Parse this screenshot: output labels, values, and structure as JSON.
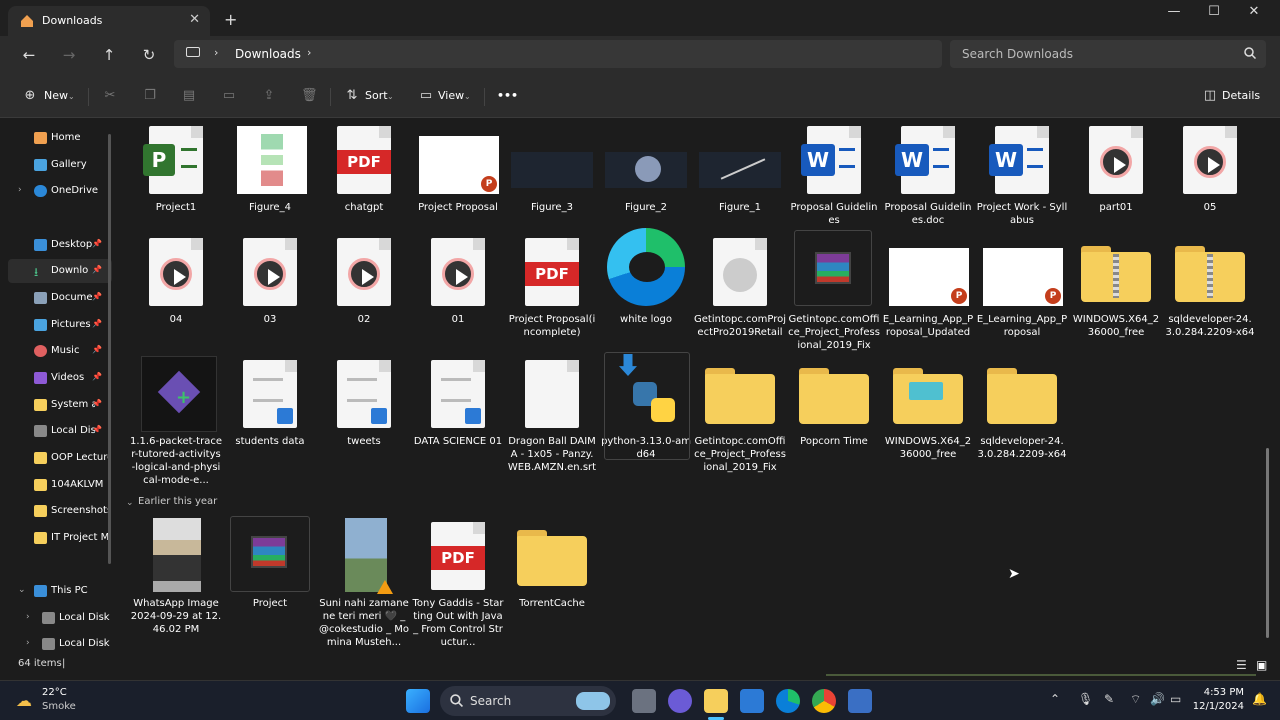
{
  "window": {
    "tab_title": "Downloads",
    "tab_close": "✕",
    "new_tab": "+",
    "minimize": "—",
    "maximize": "☐",
    "close": "✕"
  },
  "address": {
    "path": "Downloads",
    "search_placeholder": "Search Downloads"
  },
  "toolbar": {
    "new_label": "New",
    "sort_label": "Sort",
    "view_label": "View",
    "more_label": "•••",
    "details_label": "Details"
  },
  "sidebar": {
    "items": [
      {
        "label": "Home",
        "color": "#f0a050"
      },
      {
        "label": "Gallery",
        "color": "#4aa3df"
      },
      {
        "label": "OneDrive",
        "color": "#2b88d8"
      },
      {
        "label": "Desktop",
        "color": "#3a8fd9"
      },
      {
        "label": "Downlo",
        "color": "#4cc38a"
      },
      {
        "label": "Docume",
        "color": "#8aa0b8"
      },
      {
        "label": "Pictures",
        "color": "#4aa3df"
      },
      {
        "label": "Music",
        "color": "#e06060"
      },
      {
        "label": "Videos",
        "color": "#8e5ad6"
      },
      {
        "label": "System a",
        "color": "#f6cf5c"
      },
      {
        "label": "Local Dis",
        "color": "#888888"
      },
      {
        "label": "OOP Lecture",
        "color": "#f6cf5c"
      },
      {
        "label": "104AKLVM",
        "color": "#f6cf5c"
      },
      {
        "label": "Screenshots",
        "color": "#f6cf5c"
      },
      {
        "label": "IT Project M",
        "color": "#f6cf5c"
      },
      {
        "label": "This PC",
        "color": "#3a8fd9"
      },
      {
        "label": "Local Disk",
        "color": "#888888"
      },
      {
        "label": "Local Disk",
        "color": "#888888"
      }
    ]
  },
  "files": {
    "row1": [
      "Project1",
      "Figure_4",
      "chatgpt",
      "Project Proposal",
      "Figure_3",
      "Figure_2",
      "Figure_1",
      "Proposal Guidelines",
      "Proposal Guidelines.doc",
      "Project Work - Syllabus",
      "part01",
      "05"
    ],
    "row2": [
      "04",
      "03",
      "02",
      "01",
      "Project Proposal(incomplete)",
      "white logo",
      "Getintopc.comProjectPro2019Retail",
      "Getintopc.comOffice_Project_Professional_2019_Fix",
      "E_Learning_App_Proposal_Updated",
      "E_Learning_App_Proposal",
      "WINDOWS.X64_236000_free",
      "sqldeveloper-24.3.0.284.2209-x64"
    ],
    "row3": [
      "1.1.6-packet-tracer-tutored-activitys-logical-and-physical-mode-e...",
      "students data",
      "tweets",
      "DATA SCIENCE 01",
      "Dragon Ball DAIMA - 1x05 - Panzy.WEB.AMZN.en.srt",
      "python-3.13.0-amd64",
      "Getintopc.comOffice_Project_Professional_2019_Fix",
      "Popcorn Time",
      "WINDOWS.X64_236000_free",
      "sqldeveloper-24.3.0.284.2209-x64"
    ],
    "group_header": "Earlier this year",
    "row4": [
      "WhatsApp Image 2024-09-29 at 12.46.02 PM",
      "Project",
      "Suni nahi zamane ne teri meri 🖤 _ @cokestudio _ Momina Musteh...",
      "Tony Gaddis - Starting Out with Java_ From Control Structur...",
      "TorrentCache"
    ]
  },
  "badges": {
    "pdf": "PDF",
    "word": "W",
    "project": "P",
    "ppt": "P"
  },
  "status": {
    "count": "64 items"
  },
  "taskbar": {
    "temp": "22°C",
    "weather": "Smoke",
    "search": "Search",
    "time": "4:53 PM",
    "date": "12/1/2024"
  },
  "colors": {
    "bg": "#1c1c1c",
    "accent": "#4cc2ff",
    "folder": "#f6cf5c"
  }
}
